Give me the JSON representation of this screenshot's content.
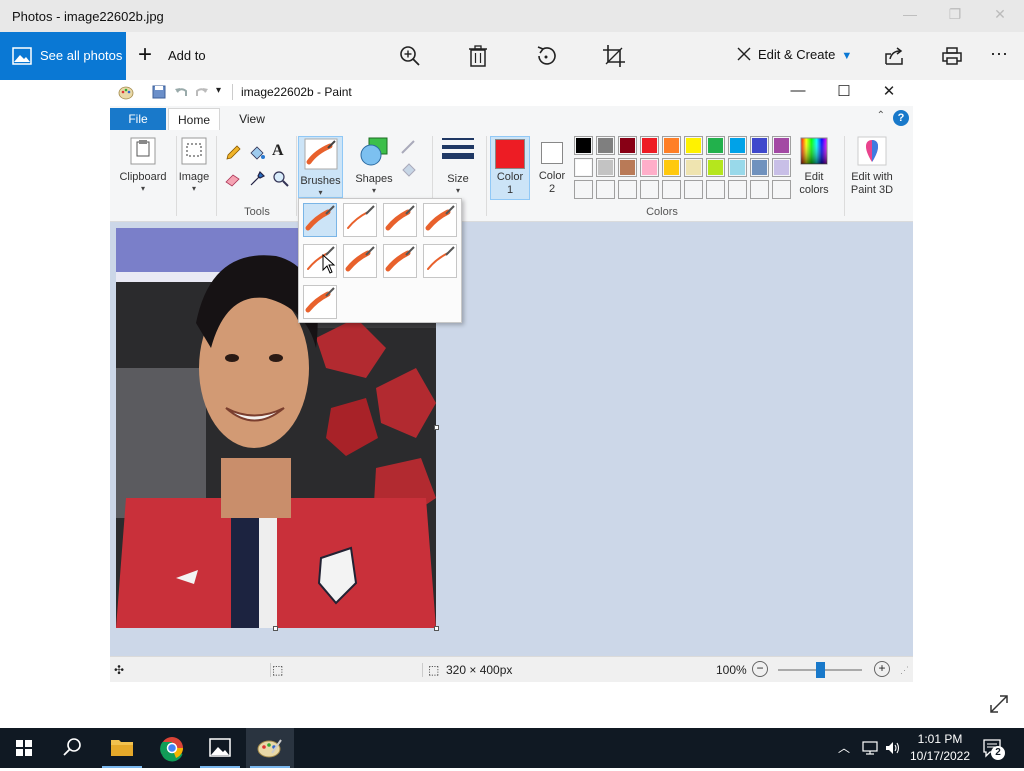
{
  "photos": {
    "title": "Photos - image22602b.jpg",
    "see_all_label": "See all photos",
    "add_to_label": "Add to",
    "edit_create_label": "Edit & Create",
    "accent": "#0a78d4"
  },
  "paint": {
    "title": "image22602b - Paint",
    "tabs": {
      "file": "File",
      "home": "Home",
      "view": "View"
    },
    "ribbon": {
      "clipboard": "Clipboard",
      "image": "Image",
      "tools": "Tools",
      "brushes": "Brushes",
      "shapes": "Shapes",
      "size": "Size",
      "color1_line1": "Color",
      "color1_line2": "1",
      "color2_line1": "Color",
      "color2_line2": "2",
      "edit_colors_line1": "Edit",
      "edit_colors_line2": "colors",
      "paint3d_line1": "Edit with",
      "paint3d_line2": "Paint 3D",
      "colors_group": "Colors"
    },
    "color1": "#ed1c24",
    "color2": "#ffffff",
    "palette_row1": [
      "#000000",
      "#7f7f7f",
      "#880015",
      "#ed1c24",
      "#ff7f27",
      "#fff200",
      "#22b14c",
      "#00a2e8",
      "#3f48cc",
      "#a349a4"
    ],
    "palette_row2": [
      "#ffffff",
      "#c3c3c3",
      "#b97a57",
      "#ffaec9",
      "#ffc90e",
      "#efe4b0",
      "#b5e61d",
      "#99d9ea",
      "#7092be",
      "#c8bfe7"
    ],
    "status": {
      "dimensions": "320 × 400px",
      "zoom": "100%"
    }
  },
  "taskbar": {
    "time": "1:01 PM",
    "date": "10/17/2022",
    "notification_count": "2"
  }
}
